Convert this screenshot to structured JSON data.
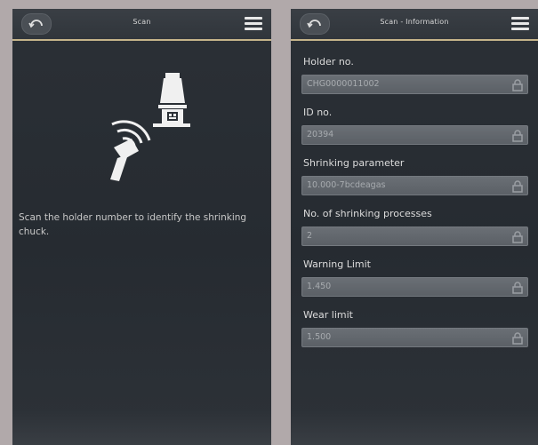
{
  "left_screen": {
    "title": "Scan",
    "instruction": "Scan the holder number to identify the shrinking chuck.",
    "icons": {
      "back": "back-arrow-icon",
      "menu": "hamburger-menu-icon",
      "illustration": "barcode-scanner-icon"
    }
  },
  "right_screen": {
    "title": "Scan - Information",
    "fields": [
      {
        "label": "Holder no.",
        "value": "CHG0000011002",
        "icon": "lock-icon"
      },
      {
        "label": "ID no.",
        "value": "20394",
        "icon": "lock-icon"
      },
      {
        "label": "Shrinking parameter",
        "value": "10.000-7bcdeagas",
        "icon": "lock-icon"
      },
      {
        "label": "No. of shrinking processes",
        "value": "2",
        "icon": "lock-icon"
      },
      {
        "label": "Warning Limit",
        "value": "1.450",
        "icon": "lock-icon"
      },
      {
        "label": "Wear limit",
        "value": "1.500",
        "icon": "lock-icon"
      }
    ]
  },
  "colors": {
    "background": "#b1a9aa",
    "screen": "#2b3036",
    "accent_line": "#c5b48a",
    "field": "#5b6066"
  }
}
